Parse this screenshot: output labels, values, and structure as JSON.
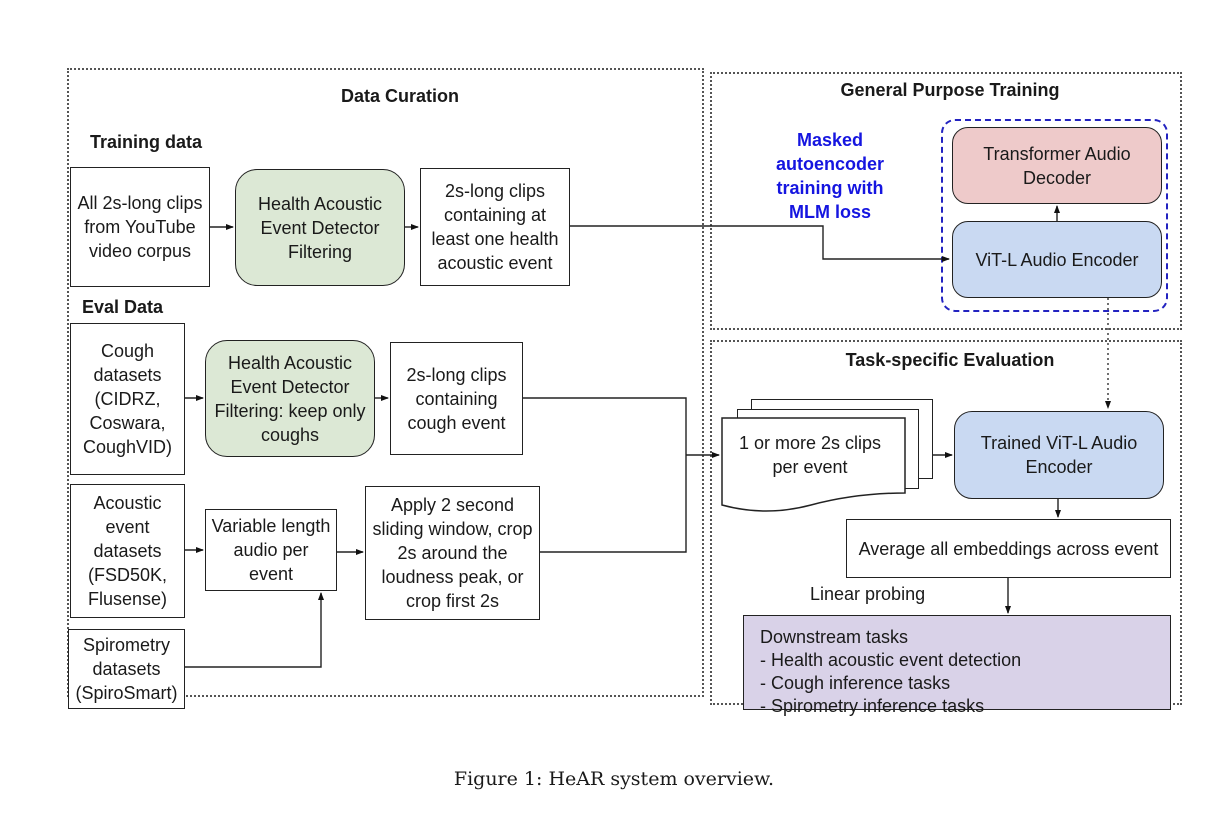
{
  "sections": {
    "data_curation": "Data Curation",
    "general_training": "General Purpose Training",
    "task_eval": "Task-specific Evaluation"
  },
  "subsections": {
    "training_data": "Training data",
    "eval_data": "Eval Data"
  },
  "nodes": {
    "youtube_clips": "All 2s-long clips from YouTube video corpus",
    "detector_filter": "Health Acoustic Event Detector Filtering",
    "health_clips": "2s-long clips containing at least one health acoustic event",
    "cough_datasets": "Cough datasets (CIDRZ, Coswara, CoughVID)",
    "detector_filter_cough": "Health Acoustic Event Detector Filtering: keep only coughs",
    "cough_clips": "2s-long clips containing cough event",
    "acoustic_datasets": "Acoustic event datasets (FSD50K, Flusense)",
    "variable_audio": "Variable length audio per event",
    "sliding_window": "Apply 2 second sliding window, crop 2s around the loudness peak, or crop first 2s",
    "spirometry_datasets": "Spirometry datasets (SpiroSmart)",
    "decoder": "Transformer Audio Decoder",
    "encoder": "ViT-L Audio Encoder",
    "clips_per_event": "1 or more 2s clips per event",
    "trained_encoder": "Trained ViT-L Audio Encoder",
    "average_embeddings": "Average all embeddings across event"
  },
  "labels": {
    "mae_training": "Masked autoencoder training with MLM loss",
    "linear_probing": "Linear probing"
  },
  "downstream": {
    "title": "Downstream tasks",
    "items": [
      "- Health acoustic event detection",
      "- Cough inference tasks",
      "- Spirometry inference tasks"
    ]
  },
  "caption": "Figure 1: HeAR system overview.",
  "colors": {
    "filter_green": "#dce8d5",
    "encoder_blue": "#c9d9f2",
    "decoder_pink": "#eecaca",
    "tasks_purple": "#d9d2e8",
    "label_blue": "#1515e0"
  }
}
